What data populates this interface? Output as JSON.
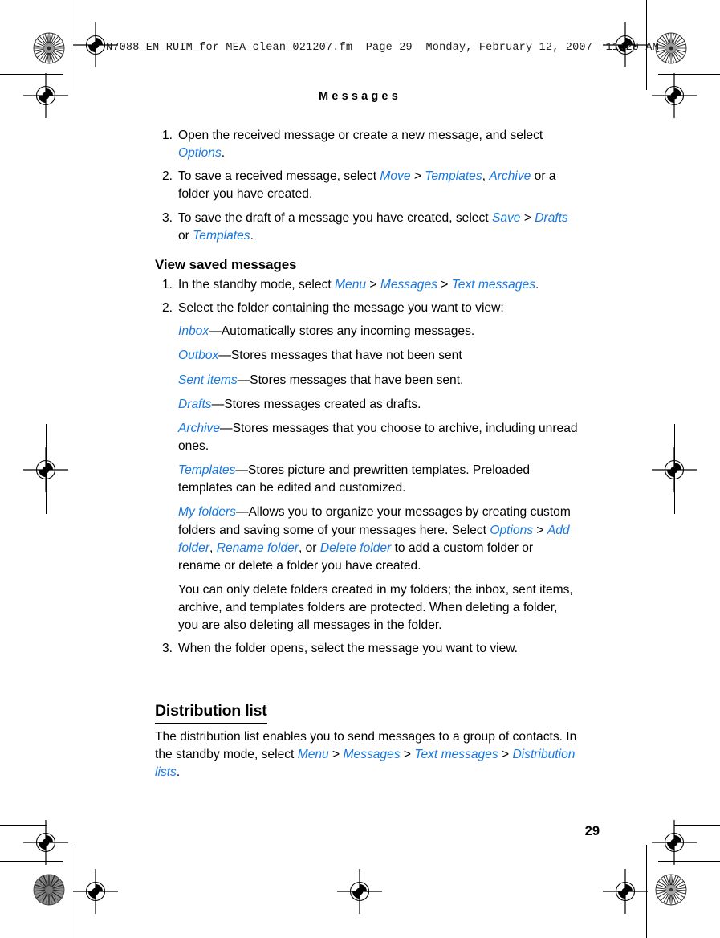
{
  "document": {
    "filestamp": "N7088_EN_RUIM_for MEA_clean_021207.fm  Page 29  Monday, February 12, 2007  11:20 AM",
    "running_header": "Messages",
    "page_number": "29",
    "link_color": "#1878e0",
    "text_color": "#000000",
    "background": "#ffffff"
  },
  "steps_save": [
    {
      "number": "1.",
      "parts": [
        {
          "t": "Open the received message or create a new message, and select ",
          "s": "plain"
        },
        {
          "t": "Options",
          "s": "link"
        },
        {
          "t": ".",
          "s": "plain"
        }
      ]
    },
    {
      "number": "2.",
      "parts": [
        {
          "t": "To save a received message, select ",
          "s": "plain"
        },
        {
          "t": "Move",
          "s": "link"
        },
        {
          "t": " > ",
          "s": "gt"
        },
        {
          "t": "Templates",
          "s": "link"
        },
        {
          "t": ", ",
          "s": "plain"
        },
        {
          "t": "Archive",
          "s": "link"
        },
        {
          "t": " or a folder you have created.",
          "s": "plain"
        }
      ]
    },
    {
      "number": "3.",
      "parts": [
        {
          "t": "To save the draft of a message you have created, select ",
          "s": "plain"
        },
        {
          "t": "Save",
          "s": "link"
        },
        {
          "t": " > ",
          "s": "gt"
        },
        {
          "t": "Drafts",
          "s": "link"
        },
        {
          "t": " or ",
          "s": "plain"
        },
        {
          "t": "Templates",
          "s": "link"
        },
        {
          "t": ".",
          "s": "plain"
        }
      ]
    }
  ],
  "view_saved": {
    "heading": "View saved messages",
    "steps": [
      {
        "number": "1.",
        "parts": [
          {
            "t": "In the standby mode, select ",
            "s": "plain"
          },
          {
            "t": "Menu",
            "s": "link"
          },
          {
            "t": " > ",
            "s": "gt"
          },
          {
            "t": "Messages",
            "s": "link"
          },
          {
            "t": " > ",
            "s": "gt"
          },
          {
            "t": "Text messages",
            "s": "link"
          },
          {
            "t": ".",
            "s": "plain"
          }
        ]
      },
      {
        "number": "2.",
        "parts": [
          {
            "t": "Select the folder containing the message you want to view:",
            "s": "plain"
          }
        ]
      }
    ],
    "folders": [
      {
        "parts": [
          {
            "t": "Inbox",
            "s": "link"
          },
          {
            "t": "—Automatically stores any incoming messages.",
            "s": "plain"
          }
        ]
      },
      {
        "parts": [
          {
            "t": "Outbox",
            "s": "link"
          },
          {
            "t": "—Stores messages that have not been sent",
            "s": "plain"
          }
        ]
      },
      {
        "parts": [
          {
            "t": "Sent items",
            "s": "link"
          },
          {
            "t": "—Stores messages that have been sent.",
            "s": "plain"
          }
        ]
      },
      {
        "parts": [
          {
            "t": "Drafts",
            "s": "link"
          },
          {
            "t": "—Stores messages created as drafts.",
            "s": "plain"
          }
        ]
      },
      {
        "parts": [
          {
            "t": "Archive",
            "s": "link"
          },
          {
            "t": "—Stores messages that you choose to archive, including unread ones.",
            "s": "plain"
          }
        ]
      },
      {
        "parts": [
          {
            "t": "Templates",
            "s": "link"
          },
          {
            "t": "—Stores picture and prewritten templates. Preloaded templates can be edited and customized.",
            "s": "plain"
          }
        ]
      },
      {
        "parts": [
          {
            "t": "My folders",
            "s": "link"
          },
          {
            "t": "—Allows you to organize your messages by creating custom folders and saving some of your messages here. Select ",
            "s": "plain"
          },
          {
            "t": "Options",
            "s": "link"
          },
          {
            "t": " > ",
            "s": "gt"
          },
          {
            "t": "Add folder",
            "s": "link"
          },
          {
            "t": ", ",
            "s": "plain"
          },
          {
            "t": "Rename folder",
            "s": "link"
          },
          {
            "t": ", or ",
            "s": "plain"
          },
          {
            "t": "Delete folder",
            "s": "link"
          },
          {
            "t": " to add a custom folder or rename or delete a folder you have created.",
            "s": "plain"
          }
        ]
      }
    ],
    "note": {
      "parts": [
        {
          "t": "You can only delete folders created in my folders; the inbox, sent items, archive, and templates folders are protected. When deleting a folder, you are also deleting all messages in the folder.",
          "s": "plain"
        }
      ]
    },
    "final_step": {
      "number": "3.",
      "parts": [
        {
          "t": "When the folder opens, select the message you want to view.",
          "s": "plain"
        }
      ]
    }
  },
  "distribution": {
    "heading": "Distribution list",
    "paragraph": {
      "parts": [
        {
          "t": "The distribution list enables you to send messages to a group of contacts. In the standby mode, select ",
          "s": "plain"
        },
        {
          "t": "Menu",
          "s": "link"
        },
        {
          "t": " > ",
          "s": "gt"
        },
        {
          "t": "Messages",
          "s": "link"
        },
        {
          "t": " > ",
          "s": "gt"
        },
        {
          "t": "Text messages",
          "s": "link"
        },
        {
          "t": " > ",
          "s": "gt"
        },
        {
          "t": "Distribution lists",
          "s": "link"
        },
        {
          "t": ".",
          "s": "plain"
        }
      ]
    }
  },
  "print_marks": {
    "registration_icon": "registration-target-icon",
    "rosette_icon": "color-rosette-icon",
    "trim_icon": "trim-line"
  }
}
